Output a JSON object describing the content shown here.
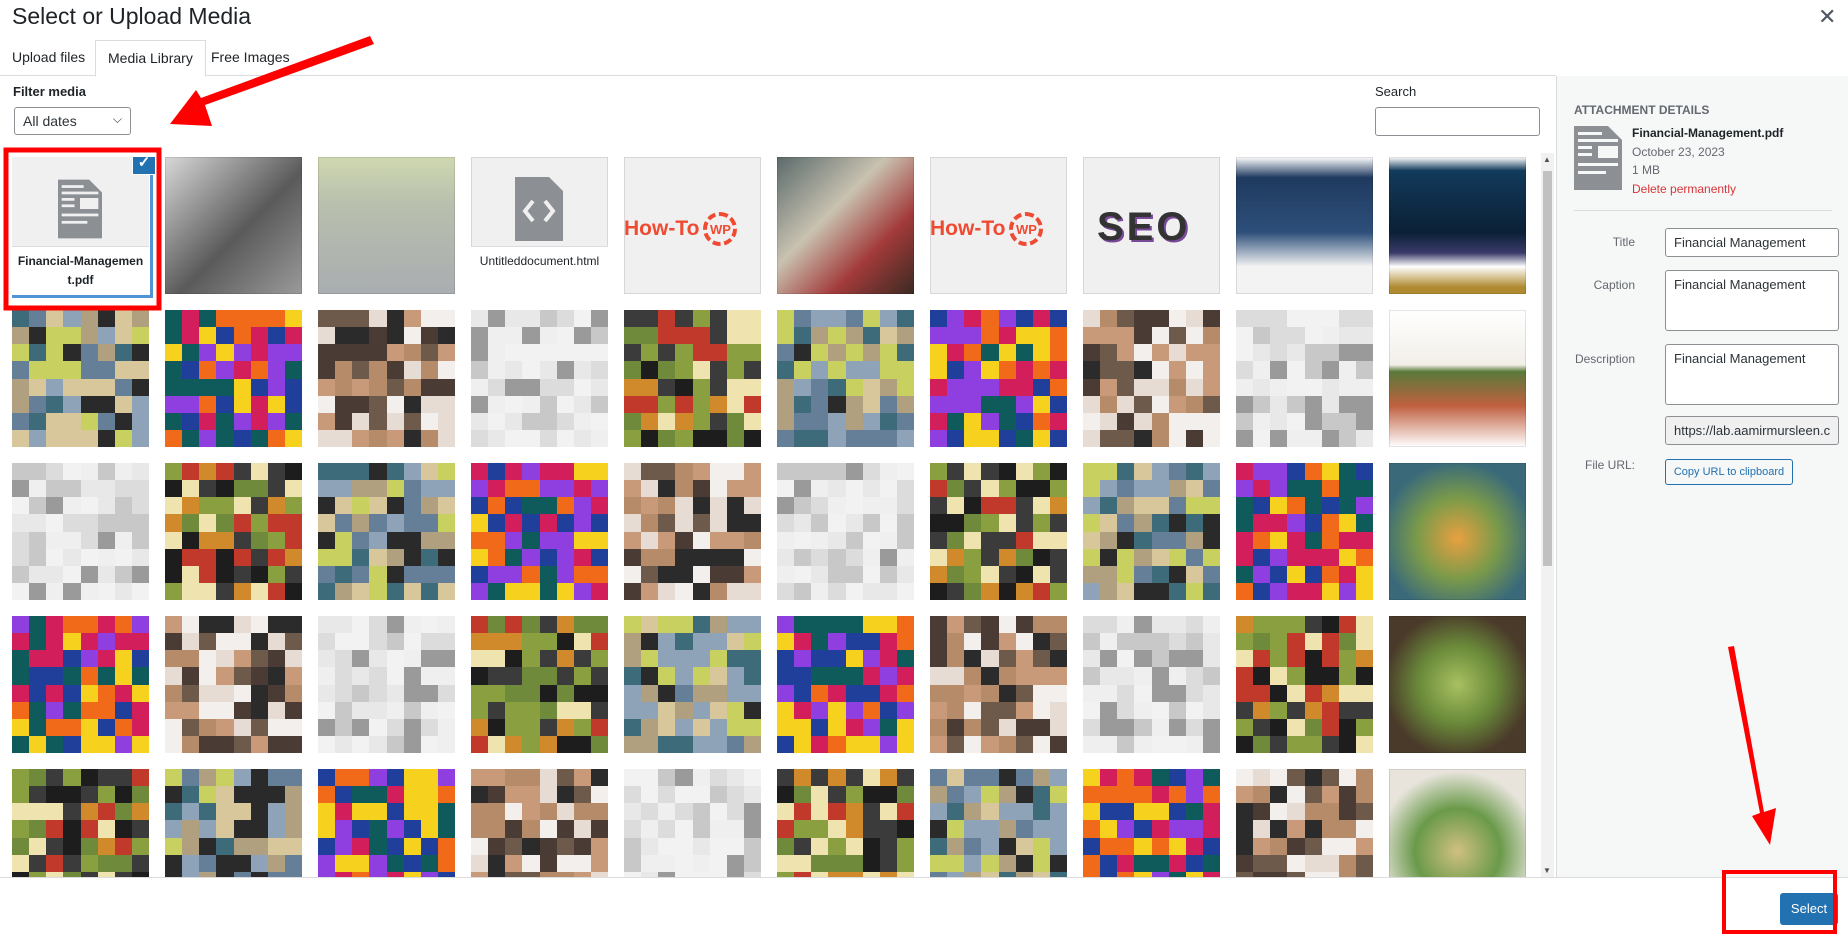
{
  "modal": {
    "title": "Select or Upload Media",
    "close_icon": "close-icon"
  },
  "tabs": [
    {
      "label": "Upload files",
      "active": false
    },
    {
      "label": "Media Library",
      "active": true
    },
    {
      "label": "Free Images",
      "active": false
    }
  ],
  "toolbar": {
    "filter_label": "Filter media",
    "date_filter": "All dates",
    "search_label": "Search",
    "search_value": ""
  },
  "grid": {
    "selected_file": "Financial-Management.pdf",
    "html_file": "Untitleddocument.html",
    "logo_text": "How-To",
    "logo_badge": "WP",
    "seo_text": "SEO"
  },
  "details": {
    "heading": "ATTACHMENT DETAILS",
    "filename": "Financial-Management.pdf",
    "date": "October 23, 2023",
    "size": "1 MB",
    "delete_label": "Delete permanently",
    "title_label": "Title",
    "title_value": "Financial Management",
    "caption_label": "Caption",
    "caption_value": "Financial Management",
    "description_label": "Description",
    "description_value": "Financial Management",
    "url_label": "File URL:",
    "url_value": "https://lab.aamirmursleen.c",
    "copy_label": "Copy URL to clipboard"
  },
  "footer": {
    "select_label": "Select"
  },
  "colors": {
    "accent": "#2271b1",
    "annotation": "#ff0000",
    "danger": "#d63638"
  }
}
